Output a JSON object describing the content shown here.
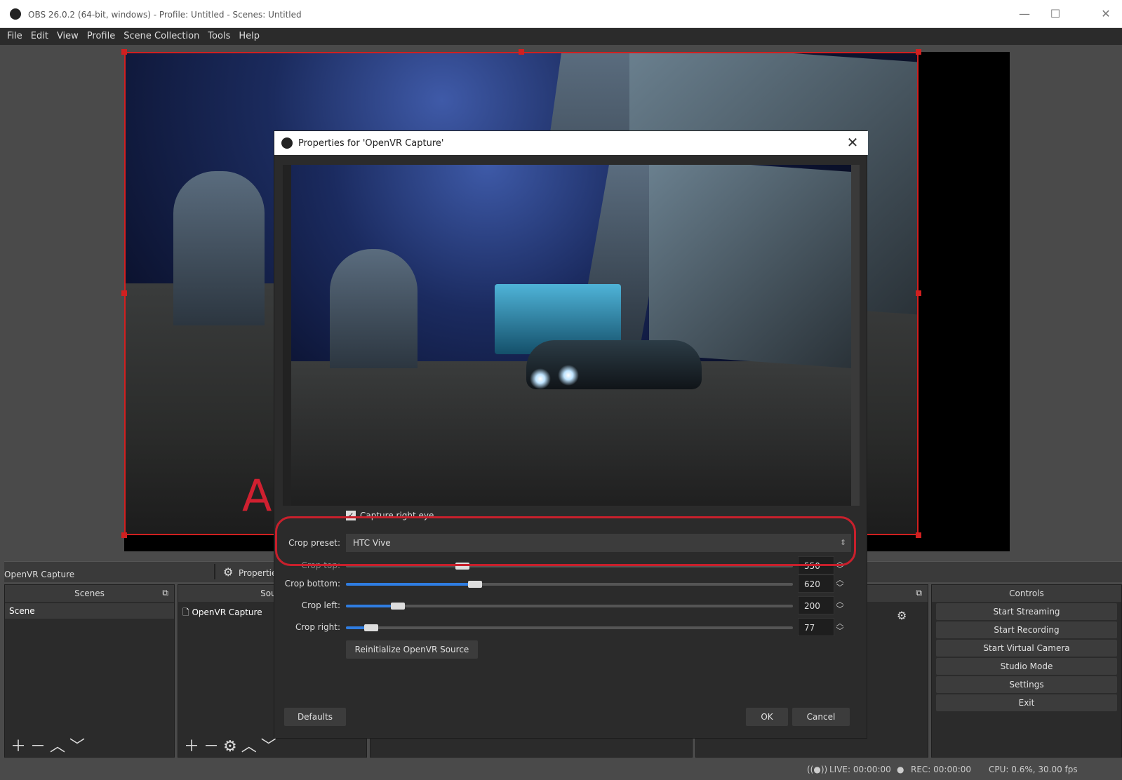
{
  "window": {
    "title": "OBS 26.0.2 (64-bit, windows) - Profile: Untitled - Scenes: Untitled",
    "minimize": "—",
    "maximize": "☐",
    "close": "✕"
  },
  "menu": [
    "File",
    "Edit",
    "View",
    "Profile",
    "Scene Collection",
    "Tools",
    "Help"
  ],
  "canvas": {
    "overlay_letter": "A"
  },
  "source_toolbar": {
    "selected_source": "OpenVR Capture",
    "properties_label": "Propertie"
  },
  "scenes": {
    "header": "Scenes",
    "items": [
      "Scene"
    ]
  },
  "sources": {
    "header": "Sourc",
    "items": [
      "OpenVR Capture"
    ]
  },
  "controls": {
    "header": "Controls",
    "buttons": [
      "Start Streaming",
      "Start Recording",
      "Start Virtual Camera",
      "Studio Mode",
      "Settings",
      "Exit"
    ]
  },
  "status": {
    "live": "LIVE: 00:00:00",
    "rec": "REC: 00:00:00",
    "cpu": "CPU: 0.6%, 30.00 fps"
  },
  "dialog": {
    "title": "Properties for 'OpenVR Capture'",
    "close": "✕",
    "capture_right_eye": {
      "label": "Capture right eye",
      "checked": true
    },
    "crop_preset": {
      "label": "Crop preset:",
      "value": "HTC Vive"
    },
    "crop_top": {
      "label": "Crop top:",
      "value": "550",
      "fraction": 0.26
    },
    "crop_bottom": {
      "label": "Crop bottom:",
      "value": "620",
      "fraction": 0.29
    },
    "crop_left": {
      "label": "Crop left:",
      "value": "200",
      "fraction": 0.1
    },
    "crop_right": {
      "label": "Crop right:",
      "value": "77",
      "fraction": 0.05
    },
    "reinit_button": "Reinitialize OpenVR Source",
    "defaults_button": "Defaults",
    "ok_button": "OK",
    "cancel_button": "Cancel"
  },
  "colors": {
    "accent": "#2f7de1",
    "selection": "#d02020",
    "highlight_ring": "#c8202c"
  }
}
